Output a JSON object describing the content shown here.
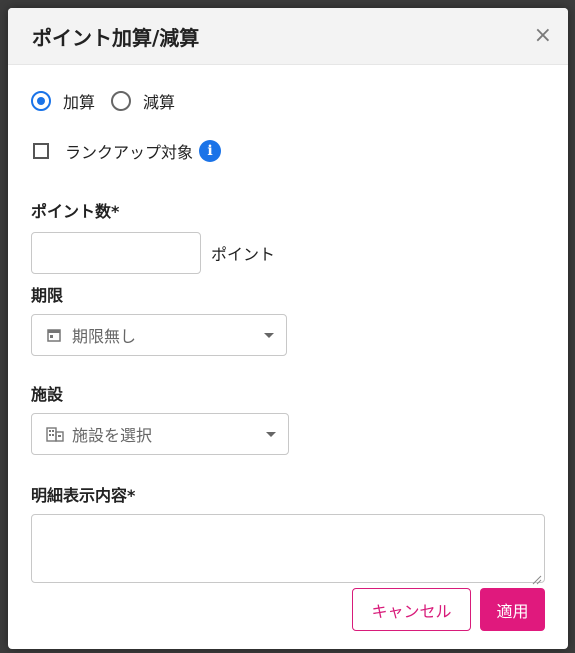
{
  "modal": {
    "title": "ポイント加算/減算",
    "close_glyph": "×"
  },
  "operation": {
    "options": [
      {
        "label": "加算",
        "selected": true
      },
      {
        "label": "減算",
        "selected": false
      }
    ]
  },
  "rank_up": {
    "label": "ランクアップ対象",
    "checked": false,
    "info_glyph": "i"
  },
  "points": {
    "label": "ポイント数*",
    "value": "",
    "suffix": "ポイント"
  },
  "deadline": {
    "label": "期限",
    "placeholder": "期限無し",
    "icon": "calendar-icon"
  },
  "facility": {
    "label": "施設",
    "placeholder": "施設を選択",
    "icon": "building-icon"
  },
  "description": {
    "label": "明細表示内容*",
    "value": ""
  },
  "buttons": {
    "cancel": "キャンセル",
    "apply": "適用"
  },
  "colors": {
    "accent": "#e0197d",
    "radio": "#1a73e8"
  }
}
